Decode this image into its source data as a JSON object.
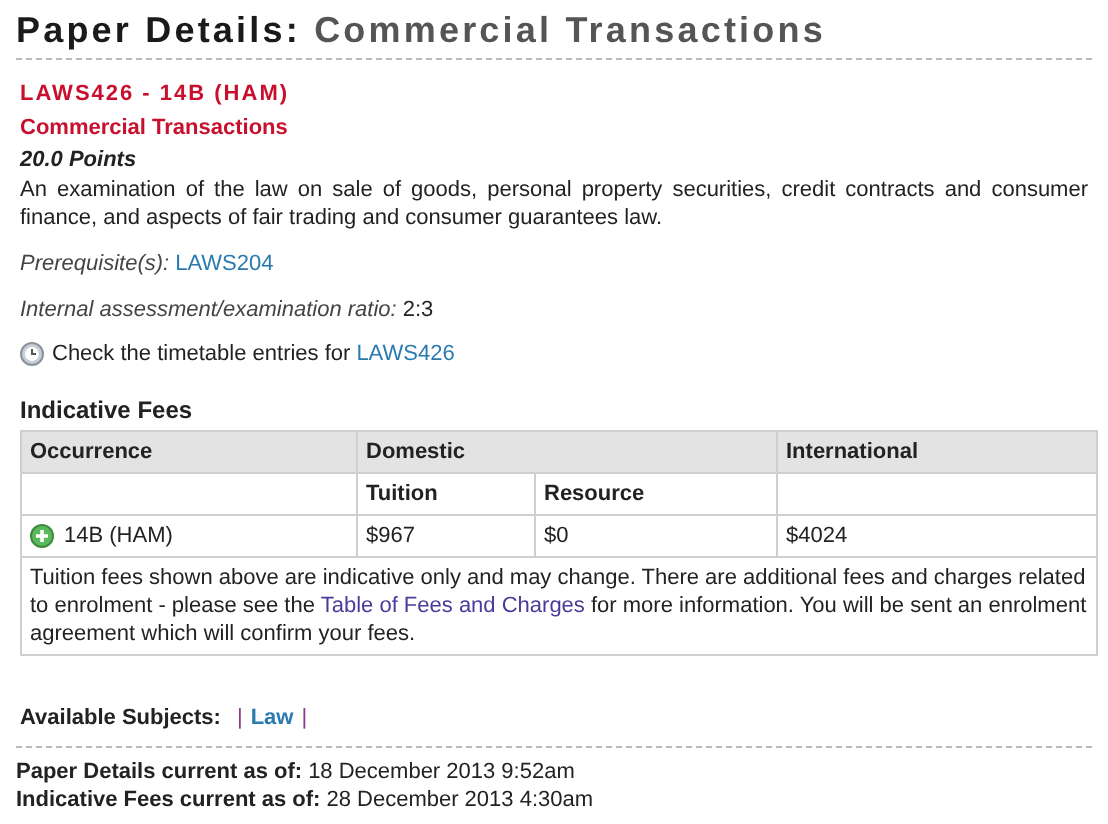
{
  "title": {
    "label": "Paper Details:",
    "subject": "Commercial Transactions"
  },
  "paper": {
    "code": "LAWS426 - 14B (HAM)",
    "name": "Commercial Transactions",
    "points": "20.0 Points",
    "description": "An examination of the law on sale of goods, personal property securities, credit contracts and consumer finance, and aspects of fair trading and consumer guarantees law.",
    "prerequisite_label": "Prerequisite(s):",
    "prerequisite_link": "LAWS204",
    "ratio_label": "Internal assessment/examination ratio:",
    "ratio": "2:3",
    "timetable_text": "Check the timetable entries for",
    "timetable_link": "LAWS426"
  },
  "fees": {
    "heading": "Indicative Fees",
    "columns": [
      "Occurrence",
      "Domestic",
      "International"
    ],
    "subcolumns": [
      "Tuition",
      "Resource"
    ],
    "rows": [
      {
        "occurrence": "14B (HAM)",
        "tuition": "$967",
        "resource": "$0",
        "international": "$4024"
      }
    ],
    "note": {
      "before": "Tuition fees shown above are indicative only and may change. There are additional fees and charges related to enrolment - please see the",
      "link": "Table of Fees and Charges",
      "after": "for more information. You will be sent an enrolment agreement which will confirm your fees."
    }
  },
  "subjects": {
    "label": "Available Subjects:",
    "leading_separator": "|",
    "links": [
      "Law"
    ],
    "trailing_separator": "|"
  },
  "updated": [
    {
      "label": "Paper Details current as of:",
      "value": "18 December 2013 9:52am"
    },
    {
      "label": "Indicative Fees current as of:",
      "value": "28 December 2013 4:30am"
    }
  ]
}
